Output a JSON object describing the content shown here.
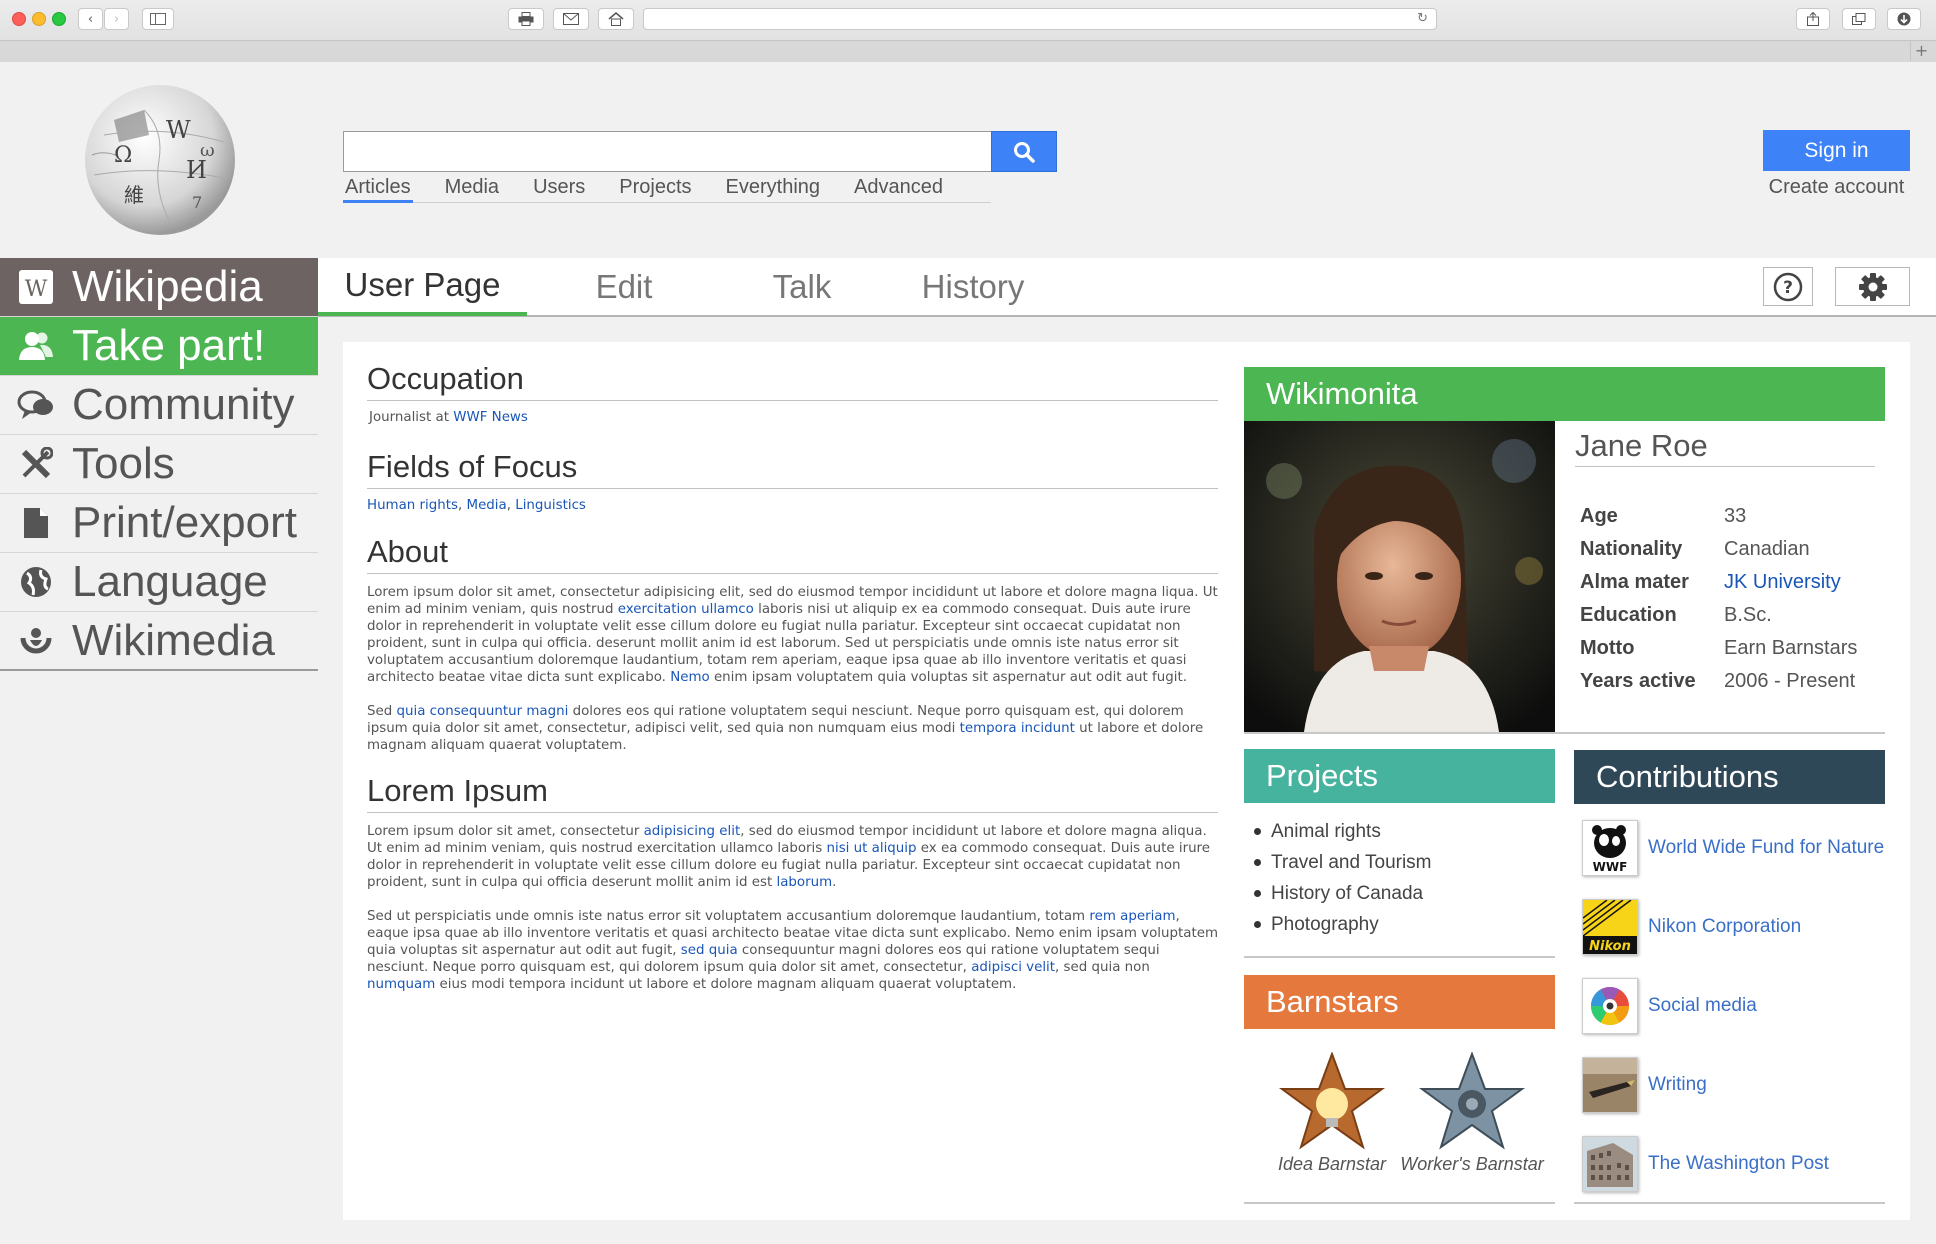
{
  "header": {
    "scope_tabs": [
      "Articles",
      "Media",
      "Users",
      "Projects",
      "Everything",
      "Advanced"
    ],
    "active_scope": "Articles",
    "signin_label": "Sign in",
    "create_account_label": "Create account"
  },
  "sidebar": {
    "items": [
      {
        "label": "Wikipedia",
        "icon": "wikipedia-w-icon"
      },
      {
        "label": "Take part!",
        "icon": "users-icon"
      },
      {
        "label": "Community",
        "icon": "chat-bubbles-icon"
      },
      {
        "label": "Tools",
        "icon": "tools-icon"
      },
      {
        "label": "Print/export",
        "icon": "document-icon"
      },
      {
        "label": "Language",
        "icon": "globe-icon"
      },
      {
        "label": "Wikimedia",
        "icon": "wikimedia-icon"
      }
    ]
  },
  "tabs": [
    "User Page",
    "Edit",
    "Talk",
    "History"
  ],
  "main": {
    "occupation": {
      "title": "Occupation",
      "prefix": "Journalist at ",
      "link": "WWF News"
    },
    "fields": {
      "title": "Fields of Focus",
      "links": [
        "Human rights",
        "Media",
        "Linguistics"
      ],
      "sep": ", "
    },
    "about": {
      "title": "About",
      "p1": [
        "Lorem ipsum dolor sit amet, consectetur adipisicing elit, sed do eiusmod tempor incididunt ut labore et dolore magna liqua. Ut enim ad minim veniam, quis nostrud ",
        "exercitation ullamco",
        " laboris nisi ut aliquip ex ea commodo consequat. Duis aute irure dolor in reprehenderit in voluptate velit esse cillum dolore eu fugiat nulla pariatur. Excepteur sint occaecat cupidatat non proident, sunt in culpa qui officia. deserunt mollit anim id est laborum. Sed ut perspiciatis unde omnis iste natus error sit voluptatem accusantium doloremque laudantium, totam rem aperiam, eaque ipsa quae ab illo inventore veritatis et quasi architecto beatae vitae dicta sunt explicabo. ",
        "Nemo",
        " enim ipsam voluptatem quia voluptas sit aspernatur aut odit aut fugit."
      ],
      "p2": [
        "Sed ",
        "quia consequuntur magni",
        " dolores eos qui ratione voluptatem sequi nesciunt. Neque porro quisquam est, qui dolorem ipsum quia dolor sit amet, consectetur, adipisci velit, sed quia non numquam eius modi ",
        "tempora incidunt",
        " ut labore et dolore magnam aliquam quaerat voluptatem."
      ]
    },
    "lorem": {
      "title": "Lorem Ipsum",
      "p1": [
        "Lorem ipsum dolor sit amet, consectetur ",
        "adipisicing elit",
        ", sed do eiusmod tempor incididunt ut labore et dolore magna aliqua. Ut enim ad minim veniam, quis nostrud exercitation ullamco laboris ",
        "nisi ut aliquip",
        " ex ea commodo consequat. Duis aute irure dolor in reprehenderit in voluptate velit esse cillum dolore eu fugiat nulla pariatur. Excepteur sint occaecat cupidatat non proident, sunt in culpa qui officia deserunt mollit anim id est ",
        "laborum",
        "."
      ],
      "p2": [
        "Sed ut perspiciatis unde omnis iste natus error sit voluptatem accusantium doloremque laudantium, totam ",
        "rem aperiam",
        ", eaque ipsa quae ab illo inventore veritatis et quasi architecto beatae vitae dicta sunt explicabo. Nemo enim ipsam voluptatem quia voluptas sit aspernatur aut odit aut fugit, ",
        "sed quia",
        " consequuntur magni dolores eos qui ratione voluptatem sequi nesciunt. Neque porro quisquam est, qui dolorem ipsum quia dolor sit amet, consectetur, ",
        "adipisci velit",
        ", sed quia non ",
        "numquam",
        " eius modi tempora incidunt ut labore et dolore magnam aliquam quaerat voluptatem."
      ]
    }
  },
  "profile": {
    "header": "Wikimonita",
    "name": "Jane Roe",
    "rows": [
      {
        "k": "Age",
        "v": "33"
      },
      {
        "k": "Nationality",
        "v": "Canadian"
      },
      {
        "k": "Alma mater",
        "v": "JK University",
        "link": true
      },
      {
        "k": "Education",
        "v": "B.Sc."
      },
      {
        "k": "Motto",
        "v": "Earn Barnstars"
      },
      {
        "k": "Years active",
        "v": "2006 - Present"
      }
    ]
  },
  "projects": {
    "title": "Projects",
    "items": [
      "Animal rights",
      "Travel and Tourism",
      "History of Canada",
      "Photography"
    ]
  },
  "barnstars": {
    "title": "Barnstars",
    "items": [
      "Idea Barnstar",
      "Worker's Barnstar"
    ]
  },
  "contributions": {
    "title": "Contributions",
    "items": [
      "World Wide Fund for Nature",
      "Nikon Corporation",
      "Social media",
      "Writing",
      "The Washington Post"
    ],
    "thumb_text": {
      "wwf": "WWF",
      "nikon": "Nikon"
    }
  },
  "colors": {
    "accent_blue": "#3e82f7",
    "green": "#4cb653",
    "teal": "#45b39d",
    "orange": "#e5783d",
    "slate": "#2f4858",
    "brand_gray": "#6c6362",
    "link": "#1a56b8"
  }
}
